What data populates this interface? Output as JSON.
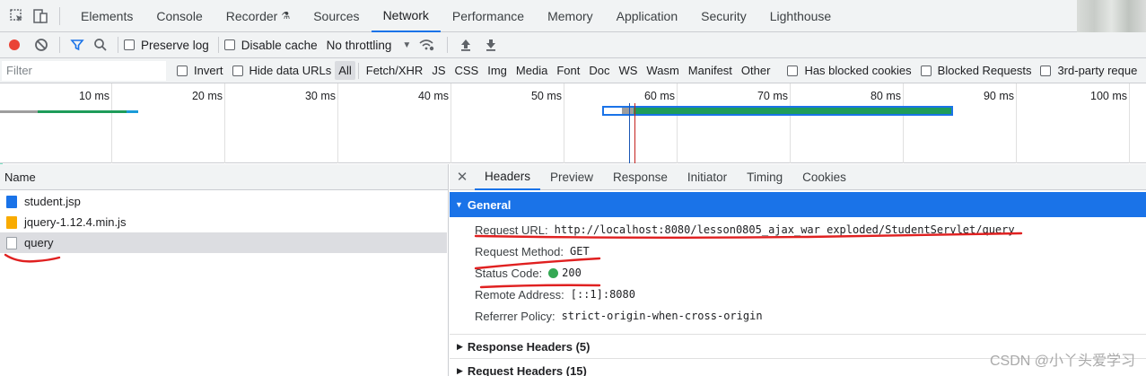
{
  "top_tabs": [
    "Elements",
    "Console",
    "Recorder",
    "Sources",
    "Network",
    "Performance",
    "Memory",
    "Application",
    "Security",
    "Lighthouse"
  ],
  "active_tab": "Network",
  "toolbar": {
    "preserve_log": "Preserve log",
    "disable_cache": "Disable cache",
    "throttling": "No throttling"
  },
  "filter": {
    "placeholder": "Filter",
    "invert": "Invert",
    "hide_data_urls": "Hide data URLs",
    "types": [
      "All",
      "Fetch/XHR",
      "JS",
      "CSS",
      "Img",
      "Media",
      "Font",
      "Doc",
      "WS",
      "Wasm",
      "Manifest",
      "Other"
    ],
    "active_type": "All",
    "has_blocked_cookies": "Has blocked cookies",
    "blocked_requests": "Blocked Requests",
    "third_party": "3rd-party reque"
  },
  "timeline": {
    "ticks": [
      "10 ms",
      "20 ms",
      "30 ms",
      "40 ms",
      "50 ms",
      "60 ms",
      "70 ms",
      "80 ms",
      "90 ms",
      "100 ms"
    ]
  },
  "requests": {
    "header": "Name",
    "rows": [
      {
        "name": "student.jsp",
        "icon": "document-icon",
        "color": "#1a73e8"
      },
      {
        "name": "jquery-1.12.4.min.js",
        "icon": "script-icon",
        "color": "#f9ab00"
      },
      {
        "name": "query",
        "icon": "xhr-icon",
        "color": "#9aa0a6"
      }
    ],
    "selected": "query"
  },
  "details": {
    "tabs": [
      "Headers",
      "Preview",
      "Response",
      "Initiator",
      "Timing",
      "Cookies"
    ],
    "active_tab": "Headers",
    "general_title": "General",
    "general": [
      {
        "key": "Request URL:",
        "value": "http://localhost:8080/lesson0805_ajax_war_exploded/StudentServlet/query"
      },
      {
        "key": "Request Method:",
        "value": "GET"
      },
      {
        "key": "Status Code:",
        "value": "200"
      },
      {
        "key": "Remote Address:",
        "value": "[::1]:8080"
      },
      {
        "key": "Referrer Policy:",
        "value": "strict-origin-when-cross-origin"
      }
    ],
    "response_headers": "Response Headers (5)",
    "request_headers": "Request Headers (15)"
  },
  "watermark": "CSDN @小丫头爱学习",
  "colors": {
    "accent": "#1a73e8",
    "record": "#ea4335",
    "status_ok": "#34a853",
    "annotation": "#e02020"
  }
}
